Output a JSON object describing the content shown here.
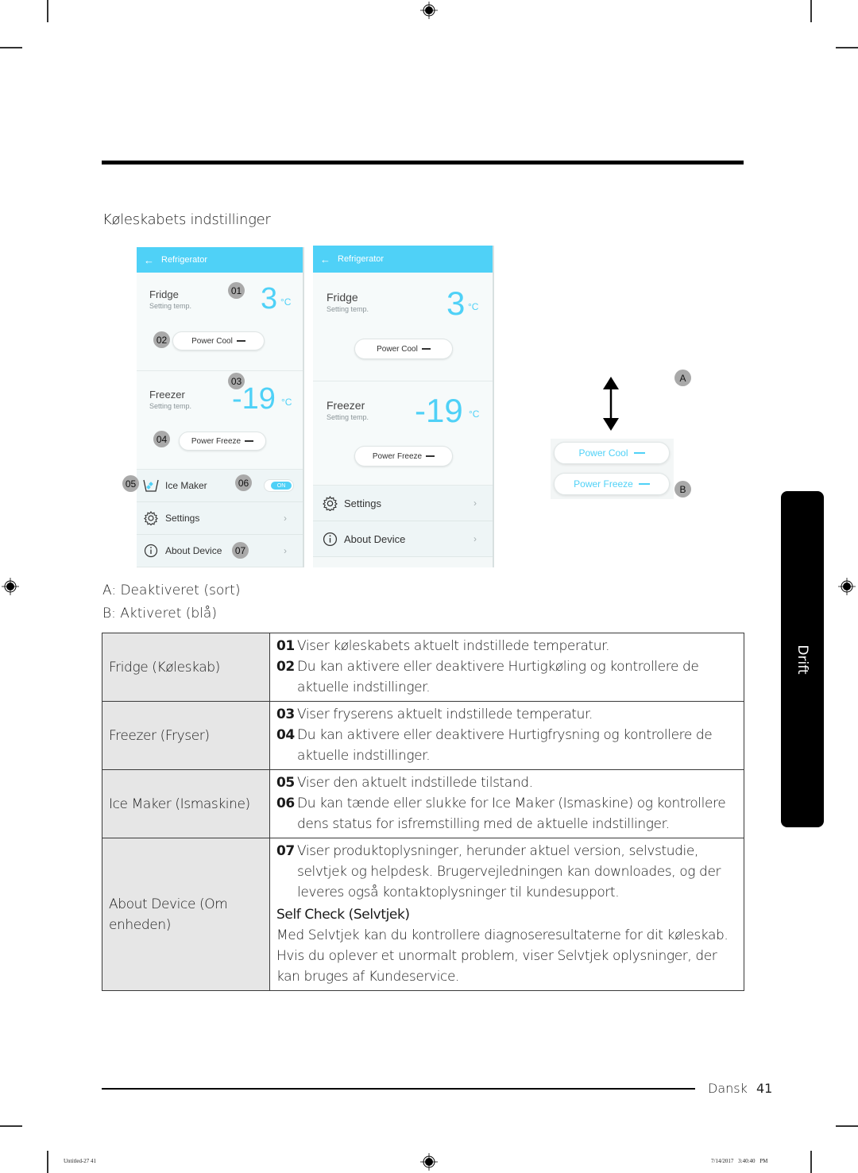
{
  "section_title": "Køleskabets indstillinger",
  "screen_left": {
    "header_title": "Refrigerator",
    "fridge": {
      "name": "Fridge",
      "sub": "Setting temp.",
      "temp": "3",
      "unit": "°C",
      "button": "Power Cool"
    },
    "freezer": {
      "name": "Freezer",
      "sub": "Setting temp.",
      "temp": "-19",
      "unit": "°C",
      "button": "Power Freeze"
    },
    "rows": [
      {
        "label": "Ice Maker",
        "icon": "ice-maker-icon",
        "toggle": "ON"
      },
      {
        "label": "Settings",
        "icon": "gear-icon"
      },
      {
        "label": "About Device",
        "icon": "info-icon"
      }
    ],
    "badges": [
      "01",
      "02",
      "03",
      "04",
      "05",
      "06",
      "07"
    ]
  },
  "screen_right": {
    "header_title": "Refrigerator",
    "fridge": {
      "name": "Fridge",
      "sub": "Setting temp.",
      "temp": "3",
      "unit": "°C",
      "button": "Power Cool"
    },
    "freezer": {
      "name": "Freezer",
      "sub": "Setting temp.",
      "temp": "-19",
      "unit": "°C",
      "button": "Power Freeze"
    },
    "rows": [
      {
        "label": "Settings",
        "icon": "gear-icon"
      },
      {
        "label": "About Device",
        "icon": "info-icon"
      }
    ]
  },
  "states": {
    "badge_a": "A",
    "badge_b": "B",
    "active_buttons": [
      "Power Cool",
      "Power Freeze"
    ],
    "accent_color": "#4fd1f7"
  },
  "legend": {
    "a": "A: Deaktiveret (sort)",
    "b": "B: Aktiveret (blå)"
  },
  "table": [
    {
      "label": "Fridge (Køleskab)",
      "items": [
        {
          "num": "01",
          "text": "Viser køleskabets aktuelt indstillede temperatur."
        },
        {
          "num": "02",
          "text": "Du kan aktivere eller deaktivere Hurtigkøling og kontrollere de aktuelle indstillinger."
        }
      ]
    },
    {
      "label": "Freezer (Fryser)",
      "items": [
        {
          "num": "03",
          "text": "Viser fryserens aktuelt indstillede temperatur."
        },
        {
          "num": "04",
          "text": "Du kan aktivere eller deaktivere Hurtigfrysning og kontrollere de aktuelle indstillinger."
        }
      ]
    },
    {
      "label": "Ice Maker (Ismaskine)",
      "items": [
        {
          "num": "05",
          "text": "Viser den aktuelt indstillede tilstand."
        },
        {
          "num": "06",
          "text": "Du kan tænde eller slukke for Ice Maker (Ismaskine) og kontrollere dens status for isfremstilling med de aktuelle indstillinger."
        }
      ]
    },
    {
      "label": "About Device (Om enheden)",
      "items": [
        {
          "num": "07",
          "text": "Viser produktoplysninger, herunder aktuel version, selvstudie, selvtjek og helpdesk. Brugervejledningen kan downloades, og der leveres også kontaktoplysninger til kundesupport."
        }
      ],
      "subheading": "Self Check (Selvtjek)",
      "paragraph": "Med Selvtjek kan du kontrollere diagnoseresultaterne for dit køleskab. Hvis du oplever et unormalt problem, viser Selvtjek oplysninger, der kan bruges af Kundeservice."
    }
  ],
  "side_tab": "Drift",
  "footer": {
    "language": "Dansk",
    "page": "41"
  },
  "print_info": {
    "left": "Untitled-27   41",
    "right": "7/14/2017   3:40:40 PM"
  }
}
